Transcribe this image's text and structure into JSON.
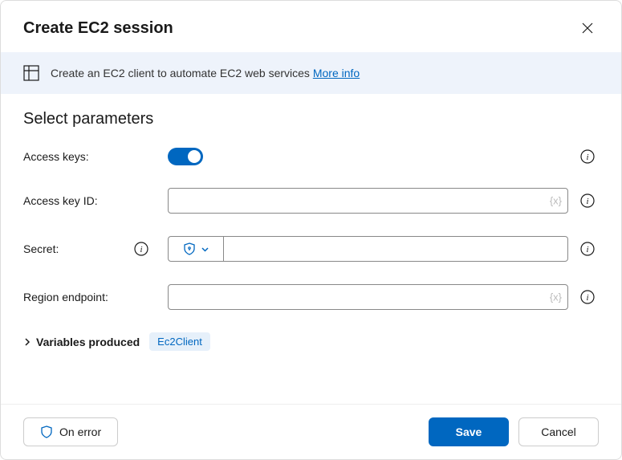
{
  "header": {
    "title": "Create EC2 session"
  },
  "banner": {
    "text": "Create an EC2 client to automate EC2 web services ",
    "link": "More info"
  },
  "section": {
    "title": "Select parameters"
  },
  "fields": {
    "access_keys": {
      "label": "Access keys:",
      "value": true
    },
    "access_key_id": {
      "label": "Access key ID:",
      "suffix": "{x}",
      "value": ""
    },
    "secret": {
      "label": "Secret:",
      "value": ""
    },
    "region_endpoint": {
      "label": "Region endpoint:",
      "suffix": "{x}",
      "value": ""
    }
  },
  "variables": {
    "label": "Variables produced",
    "badge": "Ec2Client"
  },
  "footer": {
    "on_error": "On error",
    "save": "Save",
    "cancel": "Cancel"
  }
}
